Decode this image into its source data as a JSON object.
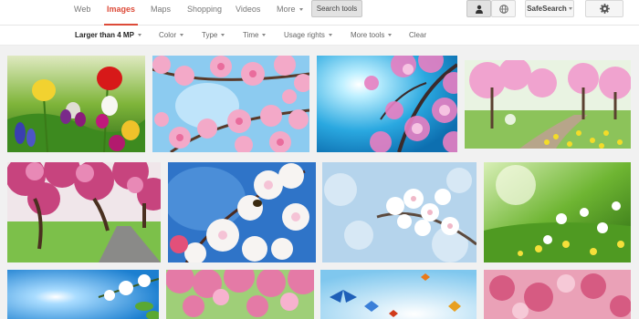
{
  "tabs": [
    {
      "label": "Web",
      "active": false
    },
    {
      "label": "Images",
      "active": true
    },
    {
      "label": "Maps",
      "active": false
    },
    {
      "label": "Shopping",
      "active": false
    },
    {
      "label": "Videos",
      "active": false
    },
    {
      "label": "More",
      "active": false
    }
  ],
  "search_tools_label": "Search tools",
  "safesearch_label": "SafeSearch",
  "filters": {
    "size": "Larger than 4 MP",
    "color": "Color",
    "type": "Type",
    "time": "Time",
    "usage": "Usage rights",
    "more": "More tools",
    "clear": "Clear"
  },
  "colors": {
    "active_tab": "#dd4b39",
    "background": "#f1f1f1"
  },
  "icons": {
    "personal": "person-icon",
    "world": "globe-icon",
    "settings": "gear-icon"
  }
}
